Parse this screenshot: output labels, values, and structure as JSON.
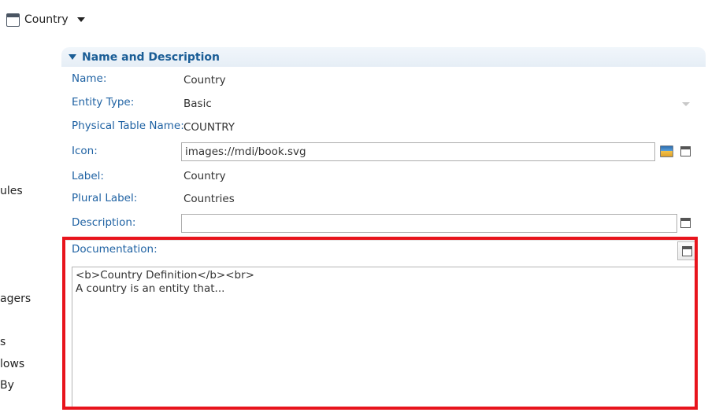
{
  "header": {
    "entity_name": "Country"
  },
  "left_nav": {
    "items": [
      "ules",
      "agers",
      "s",
      "lows",
      "By"
    ]
  },
  "section": {
    "title": "Name and Description"
  },
  "fields": {
    "name": {
      "label": "Name:",
      "value": "Country"
    },
    "entity_type": {
      "label": "Entity Type:",
      "value": "Basic"
    },
    "physical_table_name": {
      "label": "Physical Table Name:",
      "value": "COUNTRY"
    },
    "icon": {
      "label": "Icon:",
      "value": "images://mdi/book.svg"
    },
    "label": {
      "label": "Label:",
      "value": "Country"
    },
    "plural_label": {
      "label": "Plural Label:",
      "value": "Countries"
    },
    "description": {
      "label": "Description:",
      "value": ""
    },
    "documentation": {
      "label": "Documentation:",
      "value": "<b>Country Definition</b><br>\nA country is an entity that..."
    }
  },
  "colors": {
    "label_blue": "#1f62a3",
    "section_title_blue": "#1a5d96",
    "highlight_red": "#e8141c"
  },
  "icons": {
    "entity": "window-icon",
    "icon_picker": "image-picker-icon",
    "expand": "expand-window-icon"
  }
}
